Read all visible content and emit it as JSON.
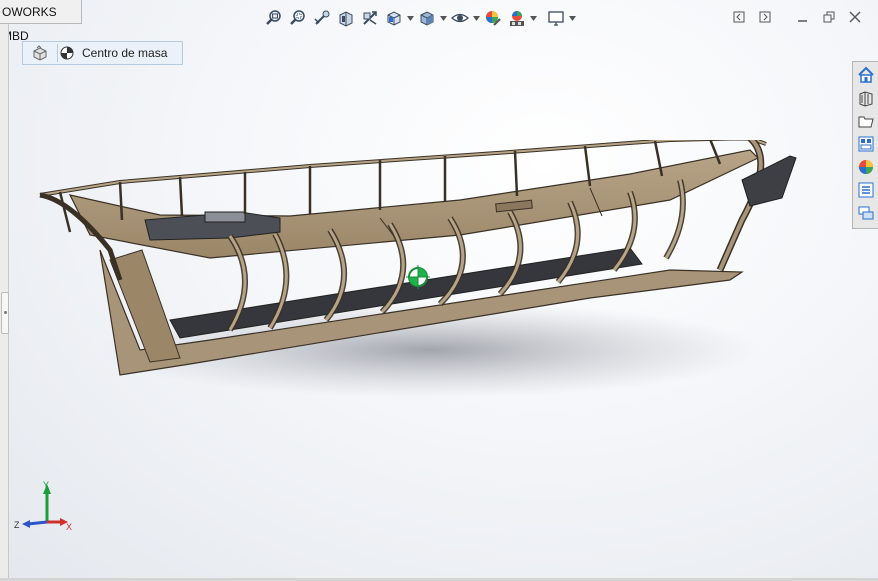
{
  "window": {
    "tab_title": "OWORKS MBD"
  },
  "breadcrumb": {
    "part_icon": "part-icon",
    "feature_icon": "center-of-mass-icon",
    "label": "Centro de masa"
  },
  "heads_up_toolbar": [
    {
      "icon": "zoom-to-fit-icon"
    },
    {
      "icon": "zoom-to-area-icon"
    },
    {
      "icon": "previous-view-icon"
    },
    {
      "icon": "section-view-icon"
    },
    {
      "icon": "dynamic-annotation-views-icon"
    },
    {
      "icon": "view-orientation-icon",
      "dropdown": true
    },
    {
      "icon": "display-style-icon",
      "dropdown": true
    },
    {
      "icon": "hide-show-items-icon",
      "dropdown": true
    },
    {
      "icon": "edit-appearance-icon"
    },
    {
      "icon": "apply-scene-icon",
      "dropdown": true
    },
    {
      "icon": "view-settings-icon",
      "dropdown": true
    }
  ],
  "window_controls": [
    "previous-window-icon",
    "next-window-icon",
    "minimize-icon",
    "restore-icon",
    "close-icon"
  ],
  "task_pane": [
    "solidworks-resources-icon",
    "design-library-icon",
    "file-explorer-icon",
    "view-palette-icon",
    "appearances-scenes-icon",
    "custom-properties-icon",
    "solidworks-forum-icon"
  ],
  "triad": {
    "x_label": "X",
    "y_label": "Y",
    "z_label": "Z"
  },
  "colors": {
    "hull_wood": "#a89478",
    "hull_dark": "#6b5a44",
    "rudder": "#3d3f44",
    "accent_blue": "#2a6fd0"
  }
}
